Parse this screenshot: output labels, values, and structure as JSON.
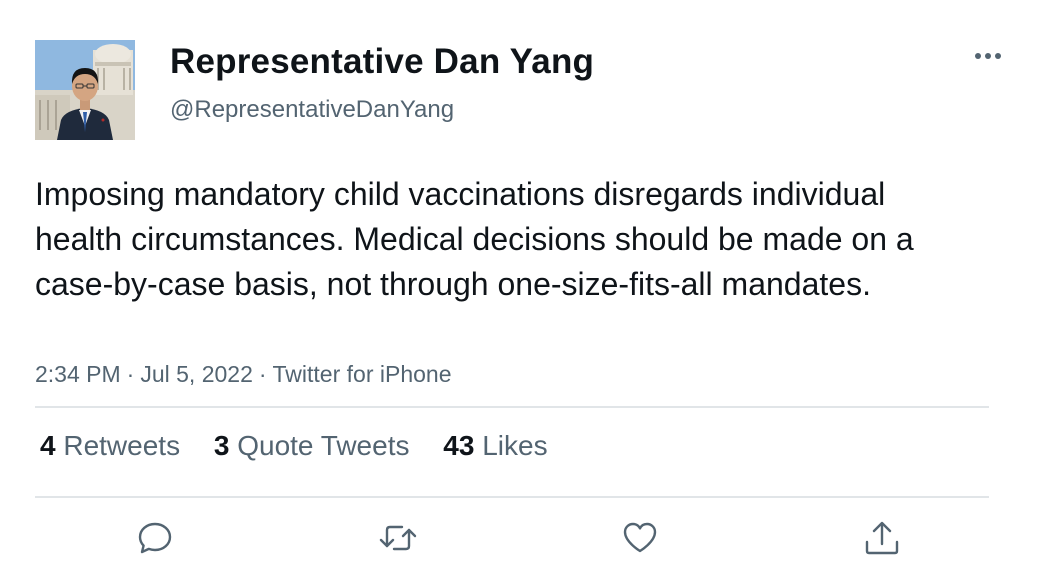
{
  "user": {
    "display_name": "Representative Dan Yang",
    "handle": "@RepresentativeDanYang",
    "avatar_icon": "person-portrait-capitol"
  },
  "tweet": {
    "text": "Imposing mandatory child vaccinations disregards individual health circumstances. Medical decisions should be made on a case-by-case basis, not through one-size-fits-all mandates.",
    "time": "2:34 PM",
    "date": "Jul 5, 2022",
    "separator": "·",
    "source": "Twitter for iPhone"
  },
  "stats": {
    "retweets": {
      "count": "4",
      "label": "Retweets"
    },
    "quote_tweets": {
      "count": "3",
      "label": "Quote Tweets"
    },
    "likes": {
      "count": "43",
      "label": "Likes"
    }
  },
  "actions": [
    "reply-icon",
    "retweet-icon",
    "like-icon",
    "share-icon"
  ],
  "colors": {
    "text_primary": "#0f1419",
    "text_secondary": "#536471",
    "divider": "#e1e5e8",
    "icon": "#536471"
  }
}
